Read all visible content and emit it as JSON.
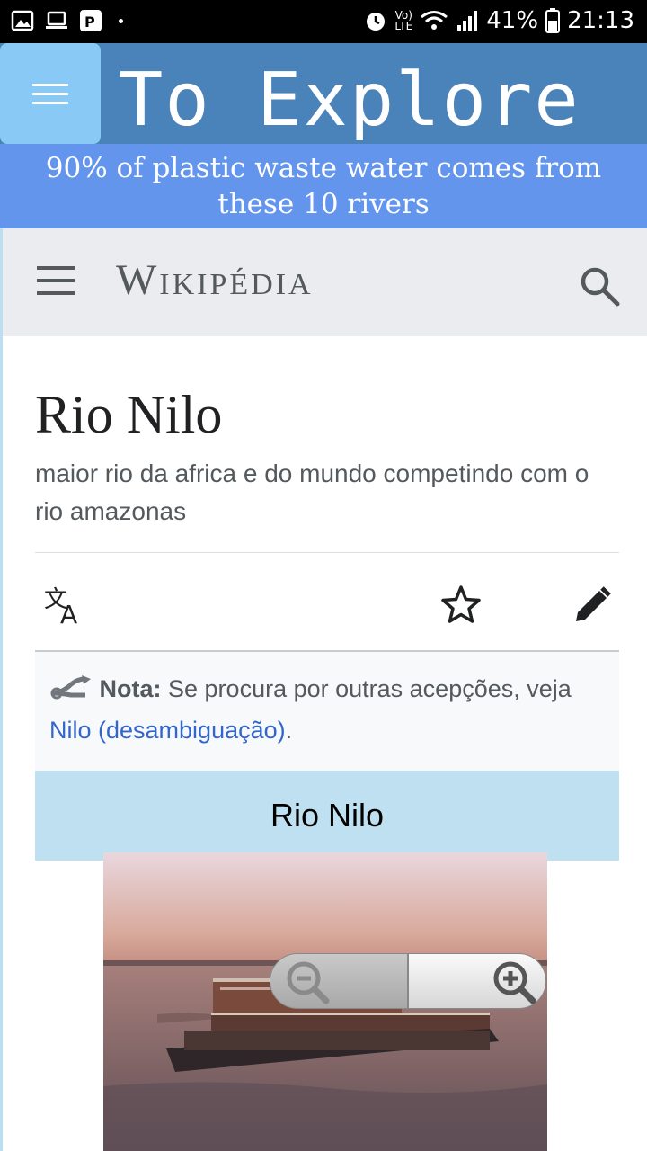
{
  "status_bar": {
    "lte_top": "Vo)",
    "lte_bottom": "LTE",
    "battery": "41%",
    "time": "21:13"
  },
  "app": {
    "title": "To Explore",
    "banner": "90% of plastic waste water comes from these 10 rivers"
  },
  "wiki": {
    "logo": "Wikipédia",
    "page_title": "Rio Nilo",
    "description": "maior rio da africa e do mundo competindo com o rio amazonas",
    "hatnote_label": "Nota:",
    "hatnote_text": " Se procura por outras acepções, veja ",
    "hatnote_link": "Nilo (desambiguação)",
    "hatnote_end": ".",
    "infobox_title": "Rio Nilo"
  },
  "colors": {
    "appbar": "#4a82ba",
    "menu_button": "#89c9f5",
    "banner": "#6495ec",
    "infobox_header": "#bfe0f0",
    "link": "#3366cc"
  }
}
